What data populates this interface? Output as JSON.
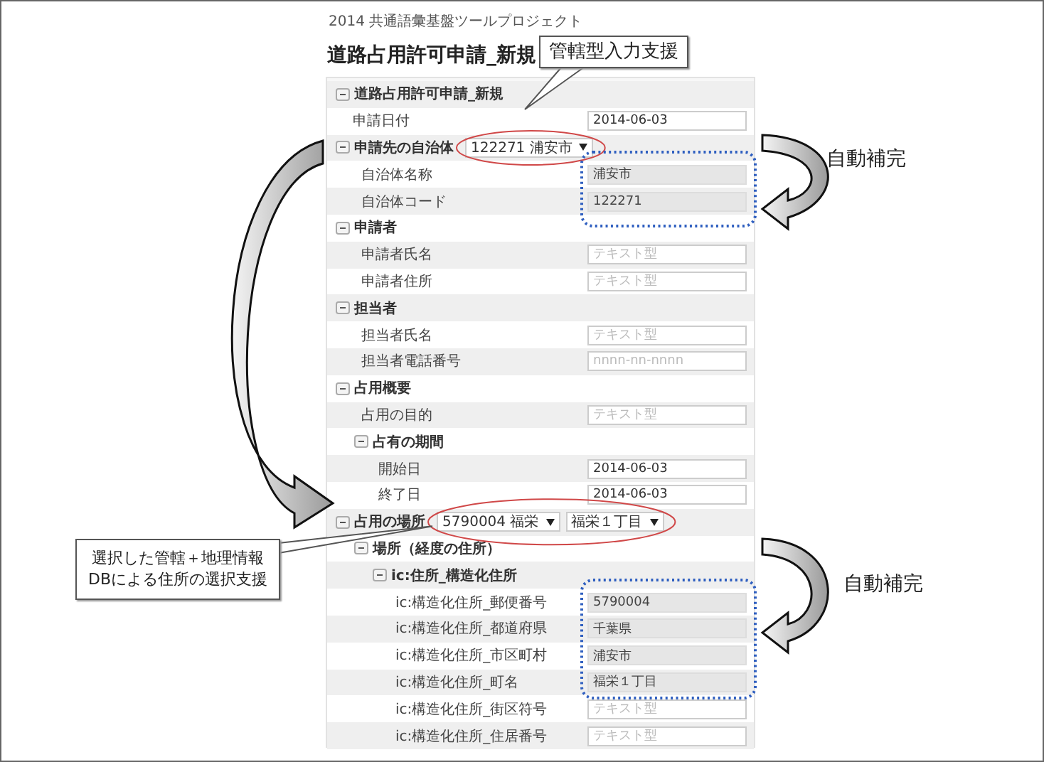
{
  "header": "2014 共通語彙基盤ツールプロジェクト",
  "title": "道路占用許可申請_新規",
  "form": {
    "items": [
      {
        "kind": "section",
        "label": "道路占用許可申請_新規",
        "expanded": true,
        "children": [
          {
            "kind": "field",
            "label": "申請日付",
            "value": "2014-06-03",
            "readonly": false
          },
          {
            "kind": "section",
            "label": "申請先の自治体",
            "expanded": true,
            "selects": [
              {
                "value": "122271 浦安市"
              }
            ],
            "children": [
              {
                "kind": "field",
                "label": "自治体名称",
                "value": "浦安市",
                "readonly": true
              },
              {
                "kind": "field",
                "label": "自治体コード",
                "value": "122271",
                "readonly": true
              }
            ]
          },
          {
            "kind": "section",
            "label": "申請者",
            "expanded": true,
            "children": [
              {
                "kind": "field",
                "label": "申請者氏名",
                "placeholder": "テキスト型",
                "readonly": false
              },
              {
                "kind": "field",
                "label": "申請者住所",
                "placeholder": "テキスト型",
                "readonly": false
              }
            ]
          },
          {
            "kind": "section",
            "label": "担当者",
            "expanded": true,
            "children": [
              {
                "kind": "field",
                "label": "担当者氏名",
                "placeholder": "テキスト型",
                "readonly": false
              },
              {
                "kind": "field",
                "label": "担当者電話番号",
                "placeholder": "nnnn-nn-nnnn",
                "readonly": false
              }
            ]
          },
          {
            "kind": "section",
            "label": "占用概要",
            "expanded": true,
            "children": [
              {
                "kind": "field",
                "label": "占用の目的",
                "placeholder": "テキスト型",
                "readonly": false
              },
              {
                "kind": "section",
                "label": "占有の期間",
                "expanded": true,
                "children": [
                  {
                    "kind": "field",
                    "label": "開始日",
                    "value": "2014-06-03",
                    "readonly": false
                  },
                  {
                    "kind": "field",
                    "label": "終了日",
                    "value": "2014-06-03",
                    "readonly": false
                  }
                ]
              }
            ]
          },
          {
            "kind": "section",
            "label": "占用の場所",
            "expanded": true,
            "selects": [
              {
                "value": "5790004 福栄"
              },
              {
                "value": "福栄１丁目"
              }
            ],
            "children": [
              {
                "kind": "section",
                "label": "場所（経度の住所）",
                "expanded": true,
                "children": [
                  {
                    "kind": "section",
                    "label": "ic:住所_構造化住所",
                    "expanded": true,
                    "children": [
                      {
                        "kind": "field",
                        "label": "ic:構造化住所_郵便番号",
                        "value": "5790004",
                        "readonly": true
                      },
                      {
                        "kind": "field",
                        "label": "ic:構造化住所_都道府県",
                        "value": "千葉県",
                        "readonly": true
                      },
                      {
                        "kind": "field",
                        "label": "ic:構造化住所_市区町村",
                        "value": "浦安市",
                        "readonly": true
                      },
                      {
                        "kind": "field",
                        "label": "ic:構造化住所_町名",
                        "value": "福栄１丁目",
                        "readonly": true
                      },
                      {
                        "kind": "field",
                        "label": "ic:構造化住所_街区符号",
                        "placeholder": "テキスト型",
                        "readonly": false
                      },
                      {
                        "kind": "field",
                        "label": "ic:構造化住所_住居番号",
                        "placeholder": "テキスト型",
                        "readonly": false
                      }
                    ]
                  }
                ]
              }
            ]
          }
        ]
      }
    ]
  },
  "callouts": [
    {
      "text": "管轄型入力支援"
    },
    {
      "text": "選択した管轄＋地理情報\nDBによる住所の選択支援"
    }
  ],
  "auto_labels": [
    "自動補完",
    "自動補完"
  ]
}
